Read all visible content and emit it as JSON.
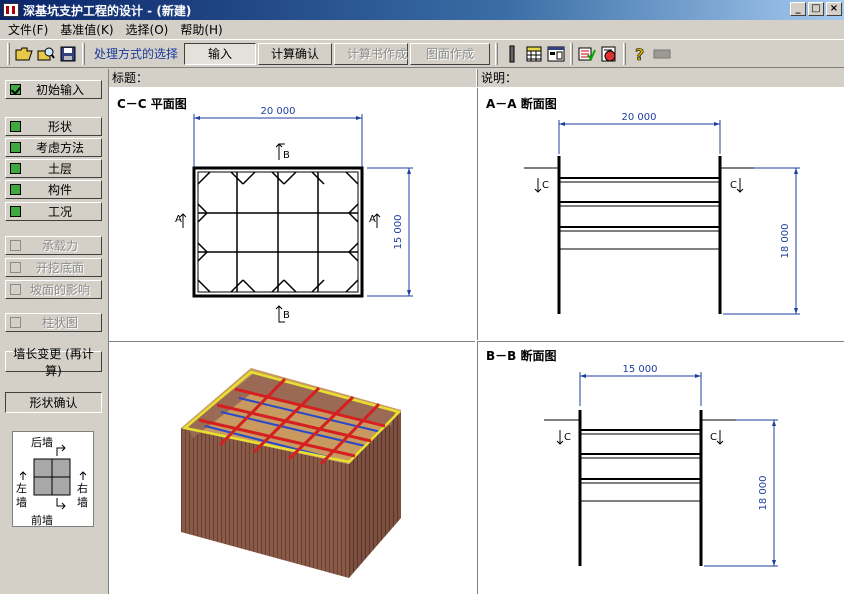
{
  "titlebar": {
    "title": "深基坑支护工程的设计 - (新建)",
    "min": "_",
    "max": "□",
    "close": "×"
  },
  "menu": [
    "文件(F)",
    "基准值(K)",
    "选择(O)",
    "帮助(H)"
  ],
  "toolbar": {
    "label": "处理方式的选择",
    "buttons": [
      "输入",
      "计算确认",
      "计算书作成",
      "图面作成"
    ]
  },
  "left": {
    "initial_input": "初始输入",
    "group1": [
      "形状",
      "考虑方法",
      "土层",
      "构件",
      "工况"
    ],
    "group2": [
      "承载力",
      "开挖底面",
      "坡面的影响"
    ],
    "column_chart": "柱状图",
    "recalc": "墙长变更 (再计算)",
    "confirm": "形状确认",
    "compass": {
      "back": "后墙",
      "front": "前墙",
      "left1": "左",
      "left2": "墙",
      "right1": "右",
      "right2": "墙"
    }
  },
  "main": {
    "title_label": "标题：",
    "desc_label": "说明：",
    "plan": {
      "title": "C－C 平面图",
      "width": "20 000",
      "height": "15 000",
      "cut_b": "B",
      "cut_a": "A"
    },
    "section_a": {
      "title": "A－A 断面图",
      "width": "20 000",
      "depth": "18 000",
      "cut": "C"
    },
    "section_b": {
      "title": "B－B 断面图",
      "width": "15 000",
      "depth": "18 000",
      "cut": "C"
    }
  },
  "colors": {
    "dimension": "#1f3fa0",
    "structure": "#000000",
    "strut_red": "#d42020",
    "wale_yellow": "#e8e030",
    "wall_brown": "#8a5a48"
  }
}
